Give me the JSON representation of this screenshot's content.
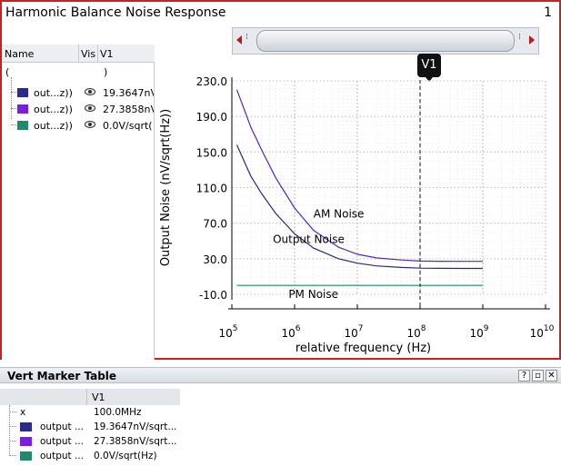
{
  "window": {
    "title": "Harmonic Balance Noise Response",
    "subwindow_number": "1"
  },
  "signal_browser": {
    "columns": {
      "name": "Name",
      "vis": "Vis",
      "v1": "V1"
    },
    "root_label": "(",
    "root_value": ")",
    "signals": [
      {
        "name": "out...z))",
        "value": "19.3647nV/",
        "color": "#2b2b8f"
      },
      {
        "name": "out...z))",
        "value": "27.3858nV/",
        "color": "#7a1fe0"
      },
      {
        "name": "out...z))",
        "value": "0.0V/sqrt(",
        "color": "#1f8a6e"
      }
    ]
  },
  "marker": {
    "label": "V1",
    "x": 100000000
  },
  "chart_data": {
    "type": "line",
    "xlabel": "relative frequency (Hz)",
    "ylabel": "Output Noise (nV/sqrt(Hz))",
    "x_scale": "log",
    "xlim": [
      100000,
      10000000000
    ],
    "ylim": [
      -10,
      230
    ],
    "yticks": [
      "230.0",
      "190.0",
      "150.0",
      "110.0",
      "70.0",
      "30.0",
      "-10.0"
    ],
    "xtick_labels": [
      {
        "base": "10",
        "exp": "5"
      },
      {
        "base": "10",
        "exp": "6"
      },
      {
        "base": "10",
        "exp": "7"
      },
      {
        "base": "10",
        "exp": "8"
      },
      {
        "base": "10",
        "exp": "9"
      },
      {
        "base": "10",
        "exp": "10"
      }
    ],
    "grid": true,
    "series": [
      {
        "name": "AM Noise",
        "color": "#5a24b8",
        "x": [
          120000,
          200000,
          300000,
          500000,
          1000000,
          2000000,
          5000000,
          10000000,
          20000000,
          50000000,
          100000000,
          200000000,
          500000000,
          1000000000
        ],
        "y": [
          220,
          178,
          152,
          121,
          87,
          62,
          43,
          35,
          31,
          28.6,
          27.4,
          27.2,
          27.1,
          27.1
        ]
      },
      {
        "name": "Output Noise",
        "color": "#2a2a7a",
        "x": [
          120000,
          200000,
          300000,
          500000,
          1000000,
          2000000,
          5000000,
          10000000,
          20000000,
          50000000,
          100000000,
          200000000,
          500000000,
          1000000000
        ],
        "y": [
          158,
          123,
          103,
          81,
          58,
          42,
          30,
          25,
          22,
          20.2,
          19.4,
          19.2,
          19.1,
          19.1
        ]
      },
      {
        "name": "PM Noise",
        "color": "#1f8a6e",
        "x": [
          120000,
          1000000000
        ],
        "y": [
          0,
          0
        ]
      }
    ]
  },
  "marker_table": {
    "title": "Vert Marker Table",
    "buttons": {
      "help": "?",
      "restore": "▫",
      "close": "✕"
    },
    "column": "V1",
    "rows": [
      {
        "name": "x",
        "value": "100.0MHz",
        "color": ""
      },
      {
        "name": "output ...",
        "value": "19.3647nV/sqrt...",
        "color": "#2b2b8f"
      },
      {
        "name": "output ...",
        "value": "27.3858nV/sqrt...",
        "color": "#7a1fe0"
      },
      {
        "name": "output ...",
        "value": "0.0V/sqrt(Hz)",
        "color": "#1f8a6e"
      }
    ]
  }
}
